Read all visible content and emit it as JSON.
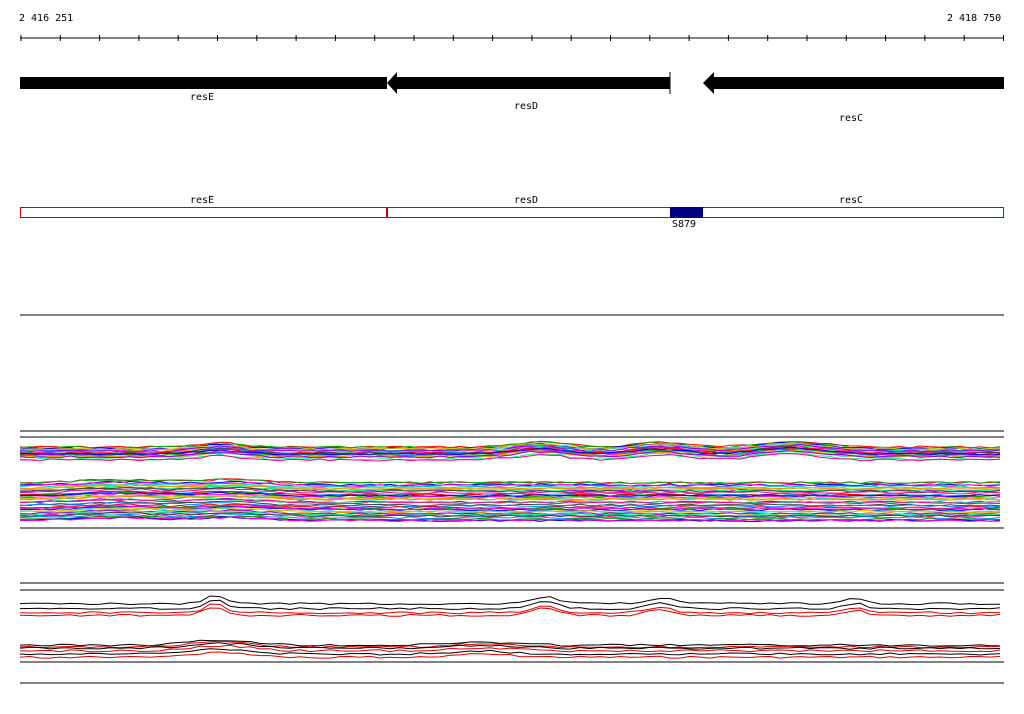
{
  "ruler": {
    "start_label": "2 416 251",
    "end_label": "2 418 750"
  },
  "genes": [
    {
      "name": "resE",
      "strand": "-"
    },
    {
      "name": "resD",
      "strand": "-"
    },
    {
      "name": "resC",
      "strand": "-"
    }
  ],
  "regions": [
    {
      "name": "resE"
    },
    {
      "name": "resD"
    },
    {
      "name": "resC"
    }
  ],
  "feature": {
    "name": "S879",
    "color": "#000080"
  },
  "colors": {
    "gene_arrow": "#000000",
    "region_outline": "#cc0000",
    "track_line": "#000000",
    "profile_red": "#dd0000"
  }
}
